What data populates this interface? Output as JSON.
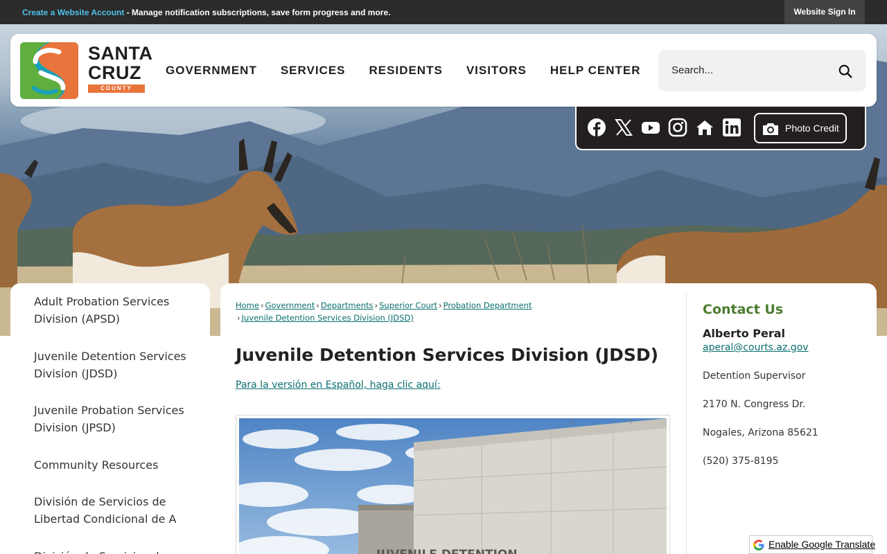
{
  "topbar": {
    "create_account_link": "Create a Website Account",
    "message": " - Manage notification subscriptions, save form progress and more.",
    "sign_in": "Website Sign In"
  },
  "logo": {
    "line1": "SANTA",
    "line2": "CRUZ",
    "line3": "COUNTY"
  },
  "nav": {
    "items": [
      {
        "label": "GOVERNMENT"
      },
      {
        "label": "SERVICES"
      },
      {
        "label": "RESIDENTS"
      },
      {
        "label": "VISITORS"
      },
      {
        "label": "HELP CENTER"
      }
    ]
  },
  "search": {
    "placeholder": "Search...",
    "icon": "search-icon"
  },
  "social": {
    "icons": [
      "facebook-icon",
      "x-icon",
      "youtube-icon",
      "instagram-icon",
      "nextdoor-icon",
      "linkedin-icon"
    ],
    "photo_credit": "Photo Credit"
  },
  "sidenav": {
    "items": [
      {
        "label": "Adult Probation Services Division (APSD)"
      },
      {
        "label": "Juvenile Detention Services Division (JDSD)"
      },
      {
        "label": "Juvenile Probation Services Division (JPSD)"
      },
      {
        "label": "Community Resources"
      },
      {
        "label": "División de Servicios de Libertad Condicional de A"
      },
      {
        "label": "División de Servicios de"
      }
    ]
  },
  "breadcrumb": {
    "items": [
      "Home",
      "Government",
      "Departments",
      "Superior Court",
      "Probation Department",
      "Juvenile Detention Services Division (JDSD)"
    ],
    "separator": "›"
  },
  "main": {
    "title": "Juvenile Detention Services Division (JDSD)",
    "spanish_link": "Para la versión en Español, haga clic aquí:",
    "photo_sign": "JUVENILE DETENTION"
  },
  "contact": {
    "header": "Contact Us",
    "name": "Alberto Peral",
    "email": "aperal@courts.az.gov",
    "title": "Detention Supervisor",
    "address1": "2170 N. Congress Dr.",
    "address2": "Nogales, Arizona 85621",
    "phone": "(520) 375-8195"
  },
  "translate": {
    "label": "Enable Google Translate"
  },
  "colors": {
    "topbar_bg": "#2b2b2b",
    "link_blue": "#4fc0e8",
    "link_teal": "#0a6e6e",
    "contact_green": "#4a7c2e",
    "logo_orange": "#e8743b",
    "logo_teal": "#1aa0b8",
    "logo_green": "#5fae3e",
    "social_bg": "#231f20"
  }
}
